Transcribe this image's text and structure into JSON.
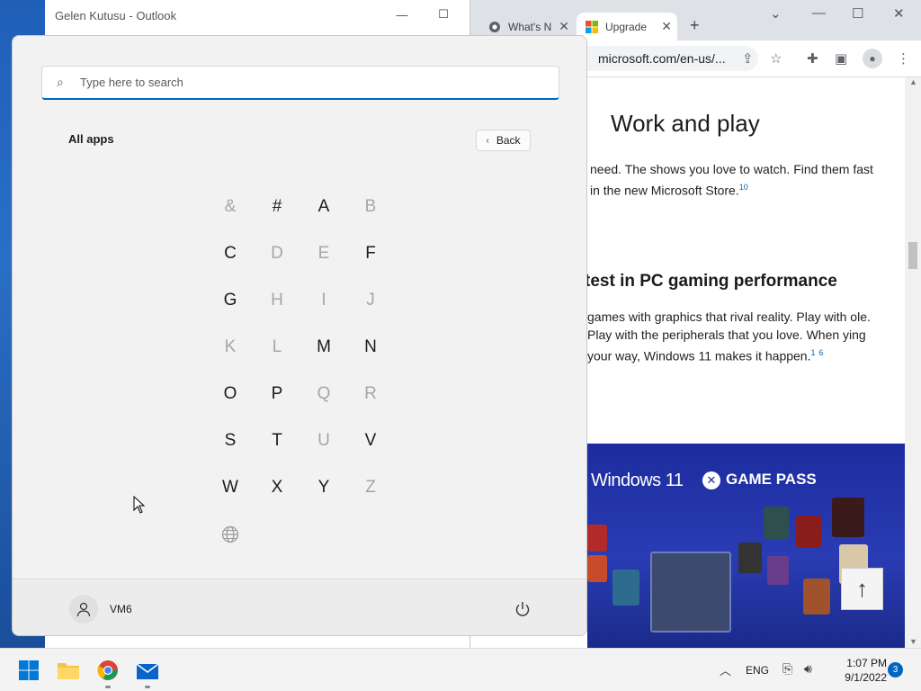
{
  "outlook": {
    "title": "Gelen Kutusu - Outlook"
  },
  "chrome": {
    "tabs": [
      {
        "label": "What's N",
        "icon": "chrome-icon"
      },
      {
        "label": "Upgrade",
        "icon": "microsoft-logo-icon"
      }
    ],
    "new_tab": "+",
    "address": "microsoft.com/en-us/...",
    "page": {
      "heading1": "Work and play",
      "para1": "need. The shows you love to watch. Find them fast in the new Microsoft Store.",
      "para1_sup": "10",
      "heading2": "test in PC gaming performance",
      "para2": "games with graphics that rival reality. Play with ole. Play with the peripherals that you love. When ying your way, Windows 11 makes it happen.",
      "para2_sup1": "1",
      "para2_sup2": "6",
      "banner_windows": "Windows 11",
      "banner_gamepass": "GAME PASS"
    }
  },
  "start_menu": {
    "search_placeholder": "Type here to search",
    "all_apps_label": "All apps",
    "back_label": "Back",
    "letters": [
      {
        "ch": "&",
        "enabled": false
      },
      {
        "ch": "#",
        "enabled": true
      },
      {
        "ch": "A",
        "enabled": true
      },
      {
        "ch": "B",
        "enabled": false
      },
      {
        "ch": "C",
        "enabled": true
      },
      {
        "ch": "D",
        "enabled": false
      },
      {
        "ch": "E",
        "enabled": false
      },
      {
        "ch": "F",
        "enabled": true
      },
      {
        "ch": "G",
        "enabled": true
      },
      {
        "ch": "H",
        "enabled": false
      },
      {
        "ch": "I",
        "enabled": false
      },
      {
        "ch": "J",
        "enabled": false
      },
      {
        "ch": "K",
        "enabled": false
      },
      {
        "ch": "L",
        "enabled": false
      },
      {
        "ch": "M",
        "enabled": true
      },
      {
        "ch": "N",
        "enabled": true
      },
      {
        "ch": "O",
        "enabled": true
      },
      {
        "ch": "P",
        "enabled": true
      },
      {
        "ch": "Q",
        "enabled": false
      },
      {
        "ch": "R",
        "enabled": false
      },
      {
        "ch": "S",
        "enabled": true
      },
      {
        "ch": "T",
        "enabled": true
      },
      {
        "ch": "U",
        "enabled": false
      },
      {
        "ch": "V",
        "enabled": true
      },
      {
        "ch": "W",
        "enabled": true
      },
      {
        "ch": "X",
        "enabled": true
      },
      {
        "ch": "Y",
        "enabled": true
      },
      {
        "ch": "Z",
        "enabled": false
      }
    ],
    "globe_icon": "globe-icon",
    "user_name": "VM6"
  },
  "taskbar": {
    "apps": [
      "start-icon",
      "file-explorer-icon",
      "chrome-icon",
      "mail-icon"
    ],
    "language": "ENG",
    "time": "1:07 PM",
    "date": "9/1/2022",
    "notification_count": "3"
  },
  "colors": {
    "accent": "#0067c0",
    "start_bg": "#f2f2f2",
    "banner": "#1c2c9e"
  }
}
